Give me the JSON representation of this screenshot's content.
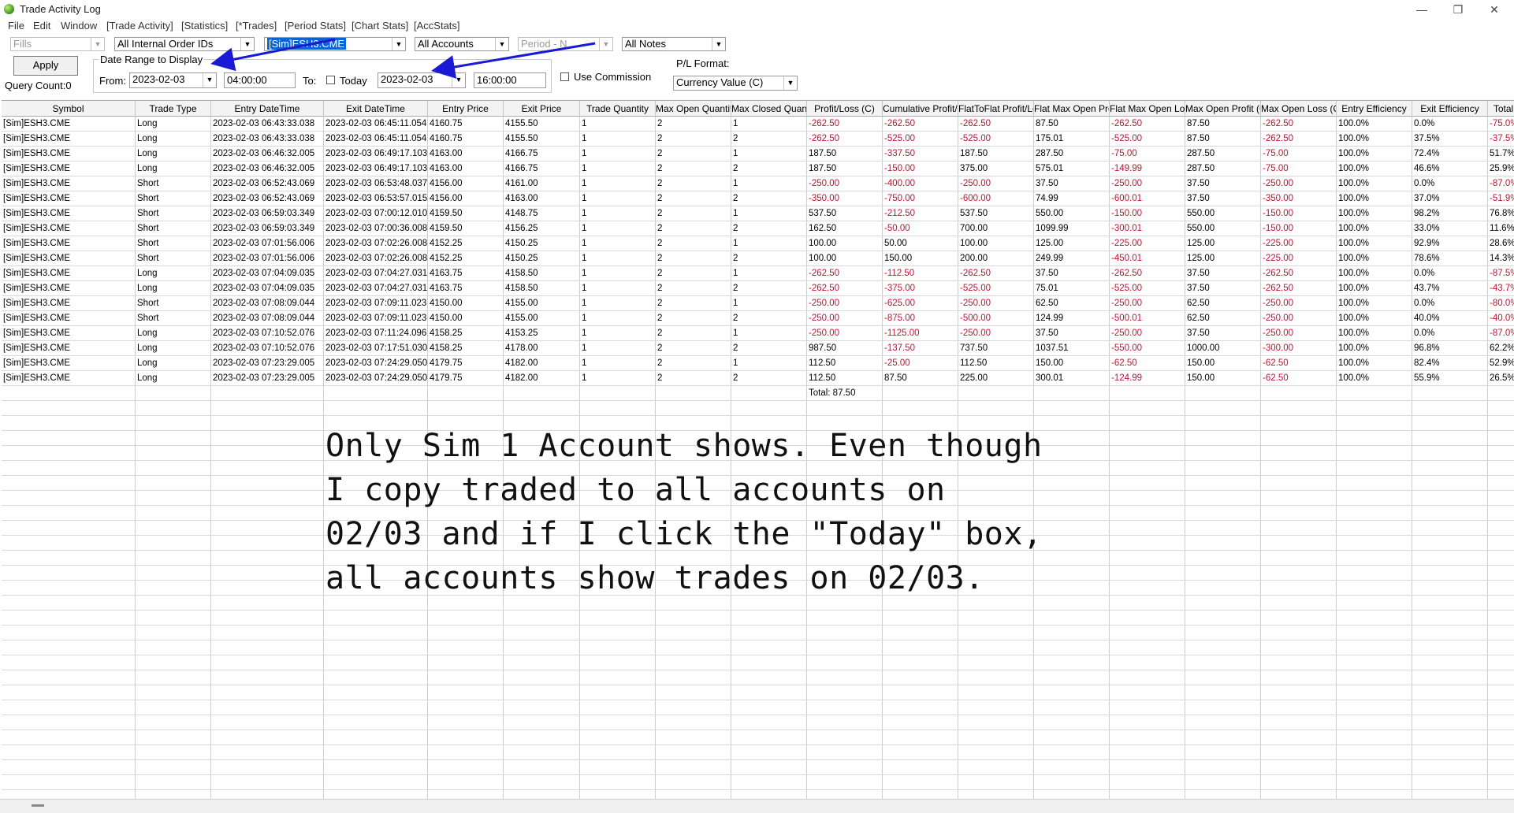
{
  "window": {
    "title": "Trade Activity Log",
    "minimize": "—",
    "maximize": "❐",
    "close": "✕"
  },
  "menu": [
    "File",
    "Edit",
    "Window",
    "[Trade Activity]",
    "[Statistics]",
    "[*Trades]",
    "[Period Stats]",
    "[Chart Stats]",
    "[AccStats]"
  ],
  "filters": {
    "fills": "Fills",
    "order_ids": "All Internal Order IDs",
    "symbol": "[Sim]ESH3.CME",
    "accounts": "All Accounts",
    "period": "Period - N",
    "notes": "All Notes"
  },
  "apply_label": "Apply",
  "query_count": "Query Count:0",
  "date_range": {
    "group_label": "Date Range to Display",
    "from_label": "From:",
    "from_date": "2023-02-03",
    "from_time": "04:00:00",
    "to_label": "To:",
    "today_label": "Today",
    "to_date": "2023-02-03",
    "to_time": "16:00:00"
  },
  "use_commission_label": "Use Commission",
  "pl_format": {
    "label": "P/L Format:",
    "value": "Currency Value (C)"
  },
  "columns": [
    "Symbol",
    "Trade Type",
    "Entry DateTime",
    "Exit DateTime",
    "Entry Price",
    "Exit Price",
    "Trade Quantity",
    "Max Open Quantity",
    "Max Closed Quantity",
    "Profit/Loss (C)",
    "Cumulative Profit/Loss",
    "FlatToFlat Profit/Loss",
    "Flat Max Open Profit",
    "Flat Max Open Loss",
    "Max Open Profit (C)",
    "Max Open Loss (C)",
    "Entry Efficiency",
    "Exit Efficiency",
    "Total"
  ],
  "rows": [
    [
      "[Sim]ESH3.CME",
      "Long",
      "2023-02-03 06:43:33.038",
      "2023-02-03 06:45:11.054",
      "4160.75",
      "4155.50",
      "1",
      "2",
      "1",
      "-262.50",
      "-262.50",
      "-262.50",
      "87.50",
      "-262.50",
      "87.50",
      "-262.50",
      "100.0%",
      "0.0%",
      "-75.0%"
    ],
    [
      "[Sim]ESH3.CME",
      "Long",
      "2023-02-03 06:43:33.038",
      "2023-02-03 06:45:11.054",
      "4160.75",
      "4155.50",
      "1",
      "2",
      "2",
      "-262.50",
      "-525.00",
      "-525.00",
      "175.01",
      "-525.00",
      "87.50",
      "-262.50",
      "100.0%",
      "37.5%",
      "-37.5%"
    ],
    [
      "[Sim]ESH3.CME",
      "Long",
      "2023-02-03 06:46:32.005",
      "2023-02-03 06:49:17.103",
      "4163.00",
      "4166.75",
      "1",
      "2",
      "1",
      "187.50",
      "-337.50",
      "187.50",
      "287.50",
      "-75.00",
      "287.50",
      "-75.00",
      "100.0%",
      "72.4%",
      "51.7%"
    ],
    [
      "[Sim]ESH3.CME",
      "Long",
      "2023-02-03 06:46:32.005",
      "2023-02-03 06:49:17.103",
      "4163.00",
      "4166.75",
      "1",
      "2",
      "2",
      "187.50",
      "-150.00",
      "375.00",
      "575.01",
      "-149.99",
      "287.50",
      "-75.00",
      "100.0%",
      "46.6%",
      "25.9%"
    ],
    [
      "[Sim]ESH3.CME",
      "Short",
      "2023-02-03 06:52:43.069",
      "2023-02-03 06:53:48.037",
      "4156.00",
      "4161.00",
      "1",
      "2",
      "1",
      "-250.00",
      "-400.00",
      "-250.00",
      "37.50",
      "-250.00",
      "37.50",
      "-250.00",
      "100.0%",
      "0.0%",
      "-87.0%"
    ],
    [
      "[Sim]ESH3.CME",
      "Short",
      "2023-02-03 06:52:43.069",
      "2023-02-03 06:53:57.015",
      "4156.00",
      "4163.00",
      "1",
      "2",
      "2",
      "-350.00",
      "-750.00",
      "-600.00",
      "74.99",
      "-600.01",
      "37.50",
      "-350.00",
      "100.0%",
      "37.0%",
      "-51.9%"
    ],
    [
      "[Sim]ESH3.CME",
      "Short",
      "2023-02-03 06:59:03.349",
      "2023-02-03 07:00:12.010",
      "4159.50",
      "4148.75",
      "1",
      "2",
      "1",
      "537.50",
      "-212.50",
      "537.50",
      "550.00",
      "-150.00",
      "550.00",
      "-150.00",
      "100.0%",
      "98.2%",
      "76.8%"
    ],
    [
      "[Sim]ESH3.CME",
      "Short",
      "2023-02-03 06:59:03.349",
      "2023-02-03 07:00:36.008",
      "4159.50",
      "4156.25",
      "1",
      "2",
      "2",
      "162.50",
      "-50.00",
      "700.00",
      "1099.99",
      "-300.01",
      "550.00",
      "-150.00",
      "100.0%",
      "33.0%",
      "11.6%"
    ],
    [
      "[Sim]ESH3.CME",
      "Short",
      "2023-02-03 07:01:56.006",
      "2023-02-03 07:02:26.008",
      "4152.25",
      "4150.25",
      "1",
      "2",
      "1",
      "100.00",
      "50.00",
      "100.00",
      "125.00",
      "-225.00",
      "125.00",
      "-225.00",
      "100.0%",
      "92.9%",
      "28.6%"
    ],
    [
      "[Sim]ESH3.CME",
      "Short",
      "2023-02-03 07:01:56.006",
      "2023-02-03 07:02:26.008",
      "4152.25",
      "4150.25",
      "1",
      "2",
      "2",
      "100.00",
      "150.00",
      "200.00",
      "249.99",
      "-450.01",
      "125.00",
      "-225.00",
      "100.0%",
      "78.6%",
      "14.3%"
    ],
    [
      "[Sim]ESH3.CME",
      "Long",
      "2023-02-03 07:04:09.035",
      "2023-02-03 07:04:27.031",
      "4163.75",
      "4158.50",
      "1",
      "2",
      "1",
      "-262.50",
      "-112.50",
      "-262.50",
      "37.50",
      "-262.50",
      "37.50",
      "-262.50",
      "100.0%",
      "0.0%",
      "-87.5%"
    ],
    [
      "[Sim]ESH3.CME",
      "Long",
      "2023-02-03 07:04:09.035",
      "2023-02-03 07:04:27.031",
      "4163.75",
      "4158.50",
      "1",
      "2",
      "2",
      "-262.50",
      "-375.00",
      "-525.00",
      "75.01",
      "-525.00",
      "37.50",
      "-262.50",
      "100.0%",
      "43.7%",
      "-43.7%"
    ],
    [
      "[Sim]ESH3.CME",
      "Short",
      "2023-02-03 07:08:09.044",
      "2023-02-03 07:09:11.023",
      "4150.00",
      "4155.00",
      "1",
      "2",
      "1",
      "-250.00",
      "-625.00",
      "-250.00",
      "62.50",
      "-250.00",
      "62.50",
      "-250.00",
      "100.0%",
      "0.0%",
      "-80.0%"
    ],
    [
      "[Sim]ESH3.CME",
      "Short",
      "2023-02-03 07:08:09.044",
      "2023-02-03 07:09:11.023",
      "4150.00",
      "4155.00",
      "1",
      "2",
      "2",
      "-250.00",
      "-875.00",
      "-500.00",
      "124.99",
      "-500.01",
      "62.50",
      "-250.00",
      "100.0%",
      "40.0%",
      "-40.0%"
    ],
    [
      "[Sim]ESH3.CME",
      "Long",
      "2023-02-03 07:10:52.076",
      "2023-02-03 07:11:24.096",
      "4158.25",
      "4153.25",
      "1",
      "2",
      "1",
      "-250.00",
      "-1125.00",
      "-250.00",
      "37.50",
      "-250.00",
      "37.50",
      "-250.00",
      "100.0%",
      "0.0%",
      "-87.0%"
    ],
    [
      "[Sim]ESH3.CME",
      "Long",
      "2023-02-03 07:10:52.076",
      "2023-02-03 07:17:51.030",
      "4158.25",
      "4178.00",
      "1",
      "2",
      "2",
      "987.50",
      "-137.50",
      "737.50",
      "1037.51",
      "-550.00",
      "1000.00",
      "-300.00",
      "100.0%",
      "96.8%",
      "62.2%"
    ],
    [
      "[Sim]ESH3.CME",
      "Long",
      "2023-02-03 07:23:29.005",
      "2023-02-03 07:24:29.050",
      "4179.75",
      "4182.00",
      "1",
      "2",
      "1",
      "112.50",
      "-25.00",
      "112.50",
      "150.00",
      "-62.50",
      "150.00",
      "-62.50",
      "100.0%",
      "82.4%",
      "52.9%"
    ],
    [
      "[Sim]ESH3.CME",
      "Long",
      "2023-02-03 07:23:29.005",
      "2023-02-03 07:24:29.050",
      "4179.75",
      "4182.00",
      "1",
      "2",
      "2",
      "112.50",
      "87.50",
      "225.00",
      "300.01",
      "-124.99",
      "150.00",
      "-62.50",
      "100.0%",
      "55.9%",
      "26.5%"
    ]
  ],
  "total_label": "Total: 87.50",
  "annotation": [
    "Only Sim 1 Account shows. Even though",
    "I copy traded to all accounts on",
    "02/03 and if I click the \"Today\" box,",
    "all accounts show trades on 02/03."
  ],
  "colors": {
    "negative": "#c8102e",
    "arrow": "#1a1ad4",
    "selection": "#0a64d6"
  }
}
